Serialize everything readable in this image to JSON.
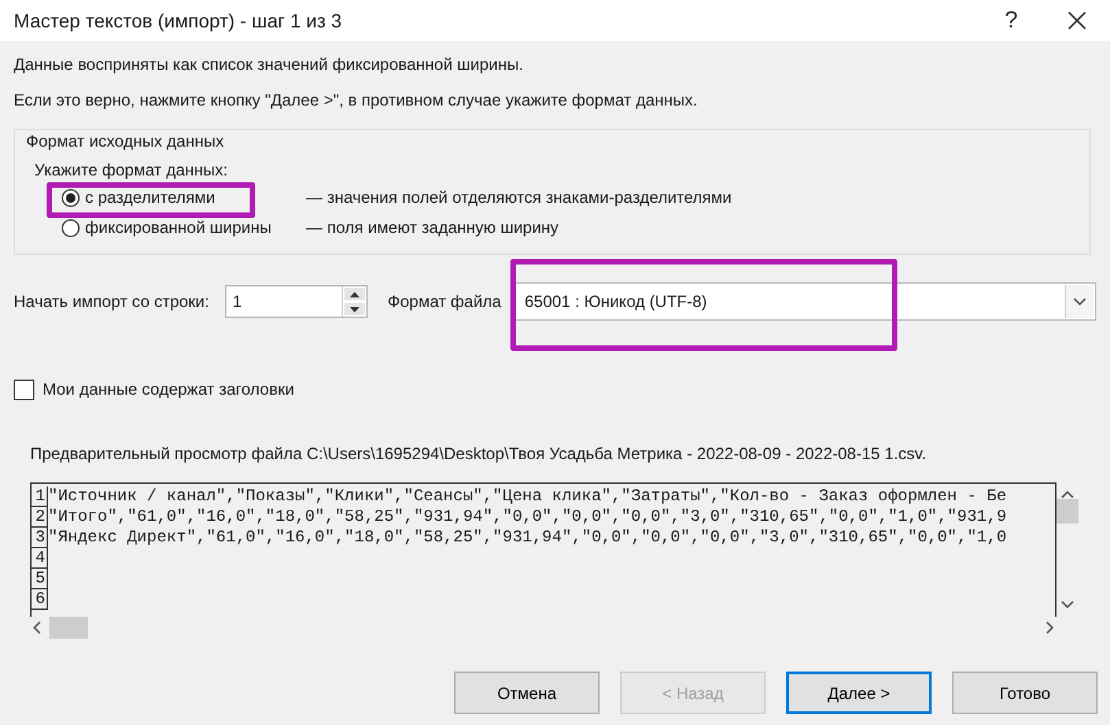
{
  "window": {
    "title": "Мастер текстов (импорт) - шаг 1 из 3",
    "help": "?"
  },
  "intro": [
    "Данные восприняты как список значений фиксированной ширины.",
    "Если это верно, нажмите кнопку \"Далее >\", в противном случае укажите формат данных."
  ],
  "source_format": {
    "legend": "Формат исходных данных",
    "prompt": "Укажите формат данных:",
    "options": [
      {
        "label": "с разделителями",
        "description": "— значения полей отделяются знаками-разделителями",
        "selected": true
      },
      {
        "label": "фиксированной ширины",
        "description": "— поля имеют заданную ширину",
        "selected": false
      }
    ]
  },
  "start_row": {
    "label": "Начать импорт со строки:",
    "value": "1"
  },
  "file_format": {
    "label": "Формат файла",
    "value": "65001 : Юникод (UTF-8)"
  },
  "headers_checkbox": {
    "label": "Мои данные содержат заголовки",
    "checked": false
  },
  "preview": {
    "label": "Предварительный просмотр файла C:\\Users\\1695294\\Desktop\\Твоя Усадьба Метрика - 2022-08-09 - 2022-08-15 1.csv.",
    "rows": [
      {
        "number": "1",
        "text": "\"Источник / канал\",\"Показы\",\"Клики\",\"Сеансы\",\"Цена клика\",\"Затраты\",\"Кол-во - Заказ оформлен - Бе"
      },
      {
        "number": "2",
        "text": "\"Итого\",\"61,0\",\"16,0\",\"18,0\",\"58,25\",\"931,94\",\"0,0\",\"0,0\",\"0,0\",\"3,0\",\"310,65\",\"0,0\",\"1,0\",\"931,9"
      },
      {
        "number": "3",
        "text": "\"Яндекс Директ\",\"61,0\",\"16,0\",\"18,0\",\"58,25\",\"931,94\",\"0,0\",\"0,0\",\"0,0\",\"3,0\",\"310,65\",\"0,0\",\"1,0"
      },
      {
        "number": "4",
        "text": ""
      },
      {
        "number": "5",
        "text": ""
      },
      {
        "number": "6",
        "text": ""
      }
    ]
  },
  "buttons": [
    {
      "label": "Отмена",
      "disabled": false,
      "default": false
    },
    {
      "label": "< Назад",
      "disabled": true,
      "default": false
    },
    {
      "label": "Далее >",
      "disabled": false,
      "default": true
    },
    {
      "label": "Готово",
      "disabled": false,
      "default": false
    }
  ]
}
